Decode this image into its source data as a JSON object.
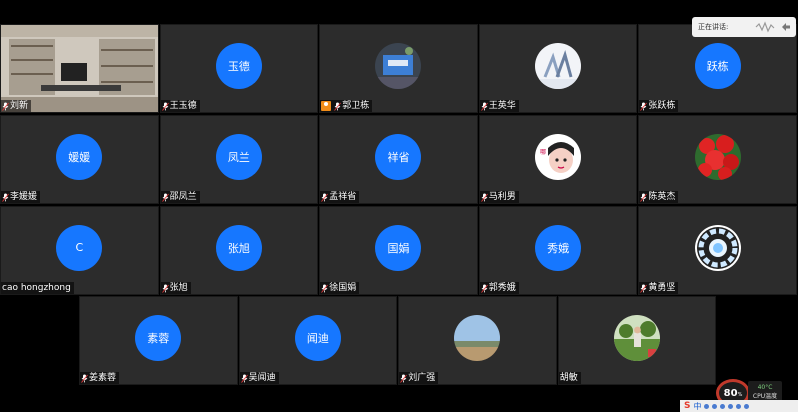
{
  "speaking_label": "正在讲话:",
  "cpu": {
    "value": "80",
    "unit": "%"
  },
  "temperature": {
    "value": "40°C",
    "label": "CPU温度"
  },
  "taskbar": {
    "ime_label": "中"
  },
  "participants": [
    {
      "name": "刘新",
      "avatar_type": "photo",
      "avatar_icon": "office-photo-icon",
      "mic": true
    },
    {
      "name": "王玉德",
      "avatar_type": "text",
      "avatar_text": "玉德",
      "mic": true
    },
    {
      "name": "郭卫栋",
      "avatar_type": "photo",
      "avatar_icon": "screen-photo-icon",
      "mic": true,
      "host": true
    },
    {
      "name": "王英华",
      "avatar_type": "photo",
      "avatar_icon": "couple-photo-icon",
      "mic": true
    },
    {
      "name": "张跃栋",
      "avatar_type": "text",
      "avatar_text": "跃栋",
      "mic": true
    },
    {
      "name": "李媛媛",
      "avatar_type": "text",
      "avatar_text": "媛媛",
      "mic": true
    },
    {
      "name": "邵凤兰",
      "avatar_type": "text",
      "avatar_text": "凤兰",
      "mic": true
    },
    {
      "name": "孟祥省",
      "avatar_type": "text",
      "avatar_text": "祥省",
      "mic": true
    },
    {
      "name": "马利男",
      "avatar_type": "photo",
      "avatar_icon": "cartoon-face-icon",
      "mic": true
    },
    {
      "name": "陈英杰",
      "avatar_type": "photo",
      "avatar_icon": "red-flowers-icon",
      "mic": true
    },
    {
      "name": "cao hongzhong",
      "avatar_type": "text",
      "avatar_text": "C",
      "mic": false
    },
    {
      "name": "张旭",
      "avatar_type": "text",
      "avatar_text": "张旭",
      "mic": true
    },
    {
      "name": "徐国娟",
      "avatar_type": "text",
      "avatar_text": "国娟",
      "mic": true
    },
    {
      "name": "郭秀娥",
      "avatar_type": "text",
      "avatar_text": "秀娥",
      "mic": true
    },
    {
      "name": "黄勇坚",
      "avatar_type": "photo",
      "avatar_icon": "arc-reactor-icon",
      "mic": true
    },
    {
      "name": "姜素蓉",
      "avatar_type": "text",
      "avatar_text": "素蓉",
      "mic": true
    },
    {
      "name": "吴闻迪",
      "avatar_type": "text",
      "avatar_text": "闻迪",
      "mic": true
    },
    {
      "name": "刘广强",
      "avatar_type": "photo",
      "avatar_icon": "landscape-photo-icon",
      "mic": true
    },
    {
      "name": "胡敏",
      "avatar_type": "photo",
      "avatar_icon": "garden-photo-icon",
      "mic": false
    }
  ],
  "colors": {
    "avatar_blue": "#1677ff",
    "tile_bg": "#2c2c2c",
    "host_orange": "#f08c18"
  }
}
